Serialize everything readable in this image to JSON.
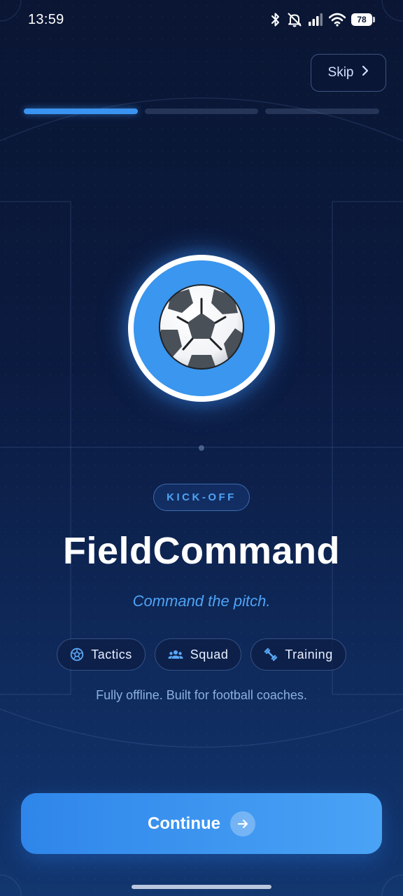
{
  "status_bar": {
    "time": "13:59",
    "battery": "78",
    "icons": [
      "bluetooth-icon",
      "bell-off-icon",
      "signal-icon",
      "wifi-icon",
      "battery-icon"
    ]
  },
  "header": {
    "skip_label": "Skip",
    "skip_icon": "chevron-right-icon"
  },
  "progress": {
    "total_steps": 3,
    "current_step": 1
  },
  "hero": {
    "icon": "soccer-ball-icon",
    "badge": "KICK-OFF",
    "title": "FieldCommand",
    "tagline": "Command the pitch."
  },
  "features": [
    {
      "label": "Tactics",
      "icon": "football-icon"
    },
    {
      "label": "Squad",
      "icon": "people-icon"
    },
    {
      "label": "Training",
      "icon": "dumbbell-icon"
    }
  ],
  "subtitle": "Fully offline. Built for football coaches.",
  "cta": {
    "label": "Continue",
    "icon": "arrow-right-icon"
  },
  "colors": {
    "accent": "#3a93f0",
    "background_top": "#0a1633",
    "background_bottom": "#12366f",
    "tagline": "#4ea3f5"
  }
}
